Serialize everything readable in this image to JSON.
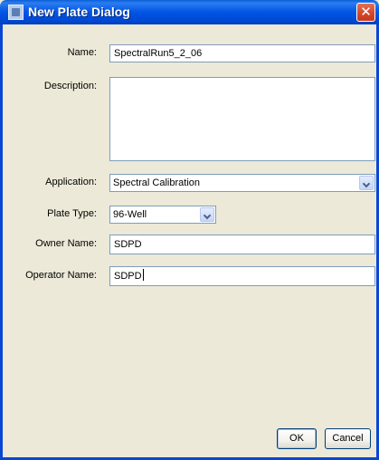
{
  "window": {
    "title": "New Plate Dialog",
    "close_glyph": "✕"
  },
  "form": {
    "name_label": "Name:",
    "name_value": "SpectralRun5_2_06",
    "description_label": "Description:",
    "description_value": "",
    "application_label": "Application:",
    "application_value": "Spectral Calibration",
    "plate_type_label": "Plate Type:",
    "plate_type_value": "96-Well",
    "owner_label": "Owner Name:",
    "owner_value": "SDPD",
    "operator_label": "Operator Name:",
    "operator_value": "SDPD"
  },
  "buttons": {
    "ok_label": "OK",
    "cancel_label": "Cancel"
  },
  "colors": {
    "titlebar": "#0055e5",
    "dialog_bg": "#ece9d8",
    "field_border": "#7f9db9",
    "close_button": "#d2452b"
  }
}
